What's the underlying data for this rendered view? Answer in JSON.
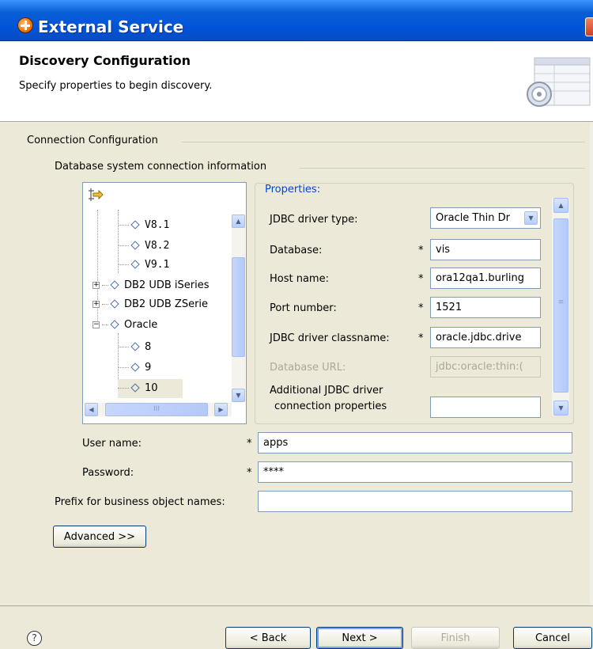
{
  "window": {
    "title": "External Service"
  },
  "header": {
    "title": "Discovery Configuration",
    "description": "Specify properties to begin discovery."
  },
  "connection_group": {
    "label": "Connection Configuration"
  },
  "database_group": {
    "label": "Database system connection information"
  },
  "tree": {
    "rows": [
      "V8.1",
      "V8.2",
      "V9.1",
      "DB2 UDB iSeries",
      "DB2 UDB ZSerie",
      "Oracle",
      "8",
      "9",
      "10"
    ],
    "hscroll_thumb": "III"
  },
  "properties": {
    "legend": "Properties:",
    "jdbc_driver_type": {
      "label": "JDBC driver type:",
      "value": "Oracle Thin Dr"
    },
    "database": {
      "label": "Database:",
      "value": "vis"
    },
    "host_name": {
      "label": "Host name:",
      "value": "ora12qa1.burling"
    },
    "port_number": {
      "label": "Port number:",
      "value": "1521"
    },
    "jdbc_driver_classname": {
      "label": "JDBC driver classname:",
      "value": "oracle.jdbc.drive"
    },
    "database_url": {
      "label": "Database URL:",
      "value": "jdbc:oracle:thin:("
    },
    "additional_props": {
      "label_line1": "Additional JDBC driver",
      "label_line2": "connection properties",
      "value": ""
    },
    "required_marker": "*"
  },
  "user_name": {
    "label": "User name:",
    "value": "apps"
  },
  "password": {
    "label": "Password:",
    "value": "****"
  },
  "prefix": {
    "label": "Prefix for business object names:",
    "value": ""
  },
  "buttons": {
    "advanced": "Advanced >>",
    "back": "< Back",
    "next": "Next >",
    "finish": "Finish",
    "cancel": "Cancel"
  },
  "help": {
    "glyph": "?"
  }
}
